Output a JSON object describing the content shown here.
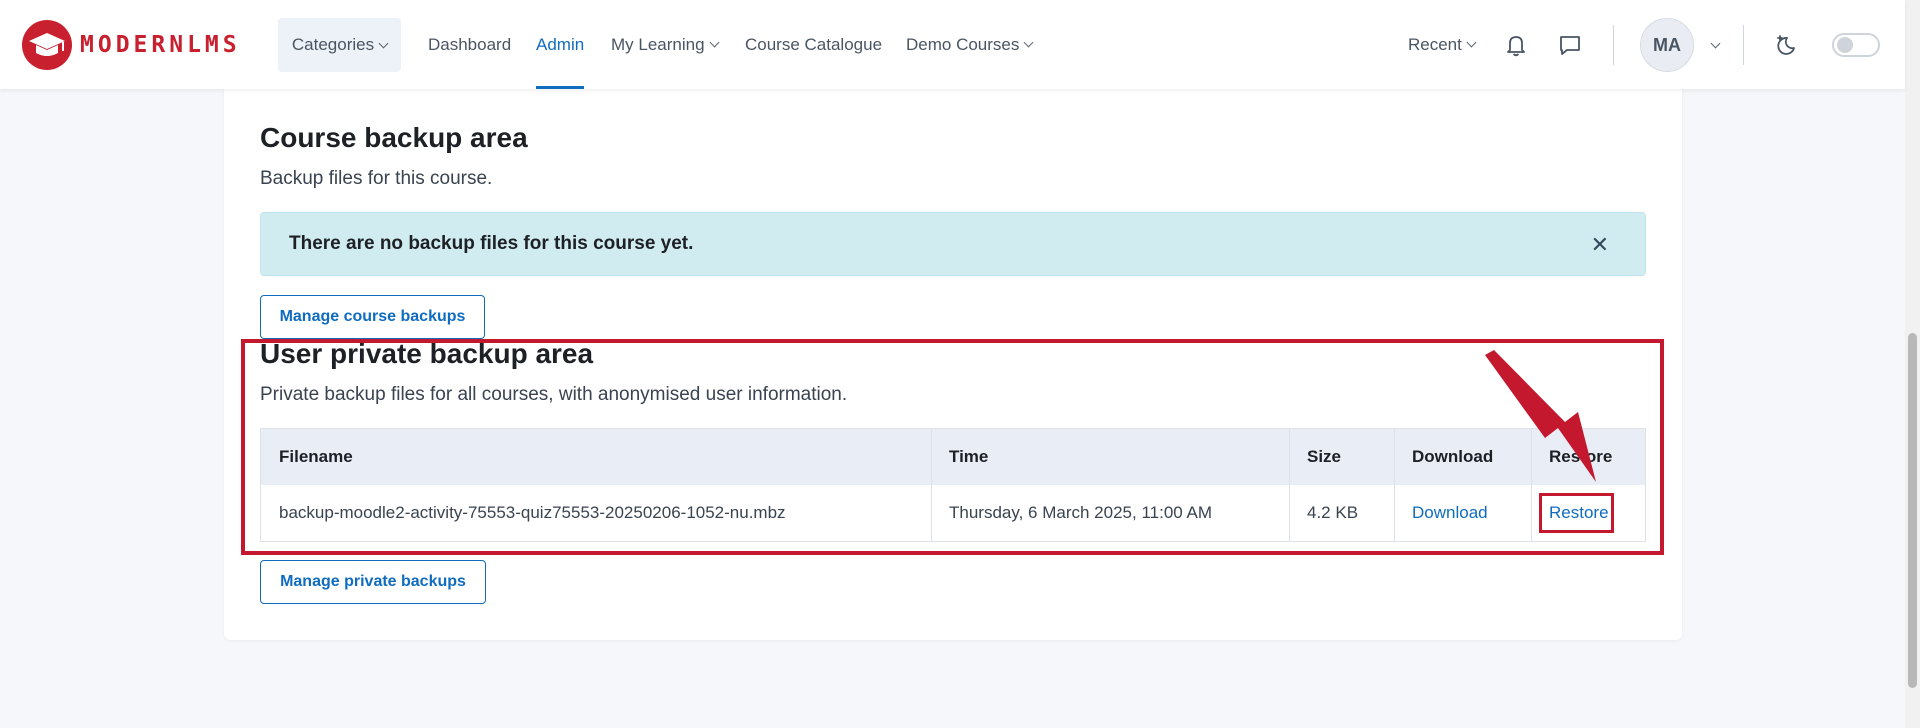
{
  "navbar": {
    "logo_text": "MODERNLMS",
    "items": [
      {
        "label": "Categories",
        "dropdown": true
      },
      {
        "label": "Dashboard",
        "dropdown": false
      },
      {
        "label": "Admin",
        "dropdown": false,
        "active": true
      },
      {
        "label": "My Learning",
        "dropdown": true
      },
      {
        "label": "Course Catalogue",
        "dropdown": false
      },
      {
        "label": "Demo Courses",
        "dropdown": true
      }
    ],
    "recent_label": "Recent",
    "avatar_initials": "MA",
    "accent_color": "#0f6cbf",
    "brand_color": "#c8202f"
  },
  "course_backup": {
    "title": "Course backup area",
    "description": "Backup files for this course.",
    "alert_text": "There are no backup files for this course yet.",
    "manage_button": "Manage course backups"
  },
  "private_backup": {
    "title": "User private backup area",
    "description": "Private backup files for all courses, with anonymised user information.",
    "table": {
      "headers": [
        "Filename",
        "Time",
        "Size",
        "Download",
        "Restore"
      ],
      "rows": [
        {
          "filename": "backup-moodle2-activity-75553-quiz75553-20250206-1052-nu.mbz",
          "time": "Thursday, 6 March 2025, 11:00 AM",
          "size": "4.2 KB",
          "download": "Download",
          "restore": "Restore"
        }
      ]
    },
    "manage_button": "Manage private backups"
  },
  "icons": [
    "logo-icon",
    "bell-icon",
    "chat-icon",
    "dark-mode-icon",
    "close-icon",
    "arrow-annotation-icon"
  ]
}
